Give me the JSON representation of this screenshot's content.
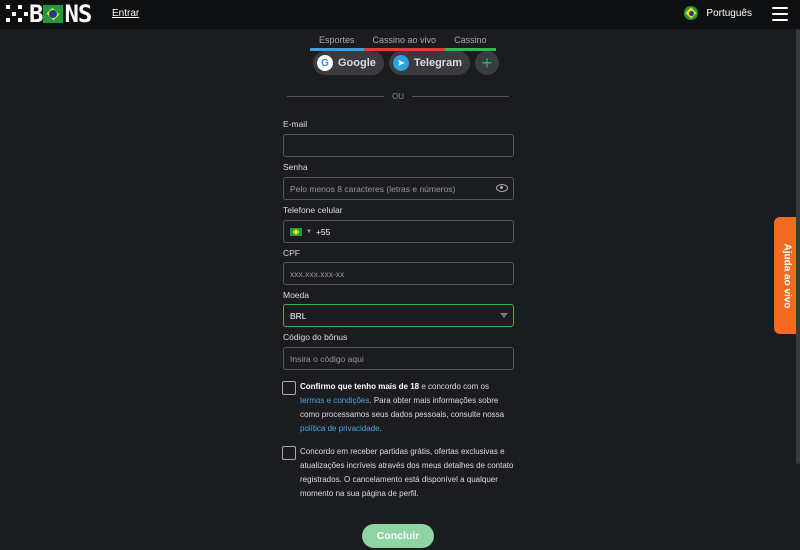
{
  "header": {
    "logo_text_1": "B",
    "logo_text_2": "NS",
    "login_label": "Entrar",
    "language": "Português"
  },
  "tabs": [
    {
      "label": "Esportes",
      "color": "#3aa0e0"
    },
    {
      "label": "Cassino ao vivo",
      "color": "#e03d3d"
    },
    {
      "label": "Cassino",
      "color": "#2fb854"
    }
  ],
  "social": {
    "google_label": "Google",
    "telegram_label": "Telegram",
    "more_label": "+"
  },
  "divider_label": "OU",
  "form": {
    "email_label": "E-mail",
    "email_value": "",
    "password_label": "Senha",
    "password_placeholder": "Pelo menos 8 caracteres (letras e números)",
    "phone_label": "Telefone celular",
    "phone_code": "+55",
    "cpf_label": "CPF",
    "cpf_placeholder": "xxx.xxx.xxx-xx",
    "currency_label": "Moeda",
    "currency_value": "BRL",
    "bonus_label": "Código do bônus",
    "bonus_placeholder": "Insira o código aqui"
  },
  "consent": {
    "age_bold": "Confirmo que tenho mais de 18",
    "age_text_1": " e concordo com os ",
    "terms_link": "termos e condições",
    "age_text_2": ". Para obter mais informações sobre como processamos seus dados pessoais, consulte nossa ",
    "privacy_link": "política de privacidade",
    "age_text_3": ".",
    "marketing_text": "Concordo em receber partidas grátis, ofertas exclusivas e atualizações incríveis através dos meus detalhes de contato registrados. O cancelamento está disponível a qualquer momento na sua página de perfil."
  },
  "submit_label": "Concluir",
  "help_label": "Ajuda ao vivo",
  "colors": {
    "accent_green": "#2fb854",
    "help_orange": "#f26b21",
    "link_blue": "#4aa8e8"
  }
}
